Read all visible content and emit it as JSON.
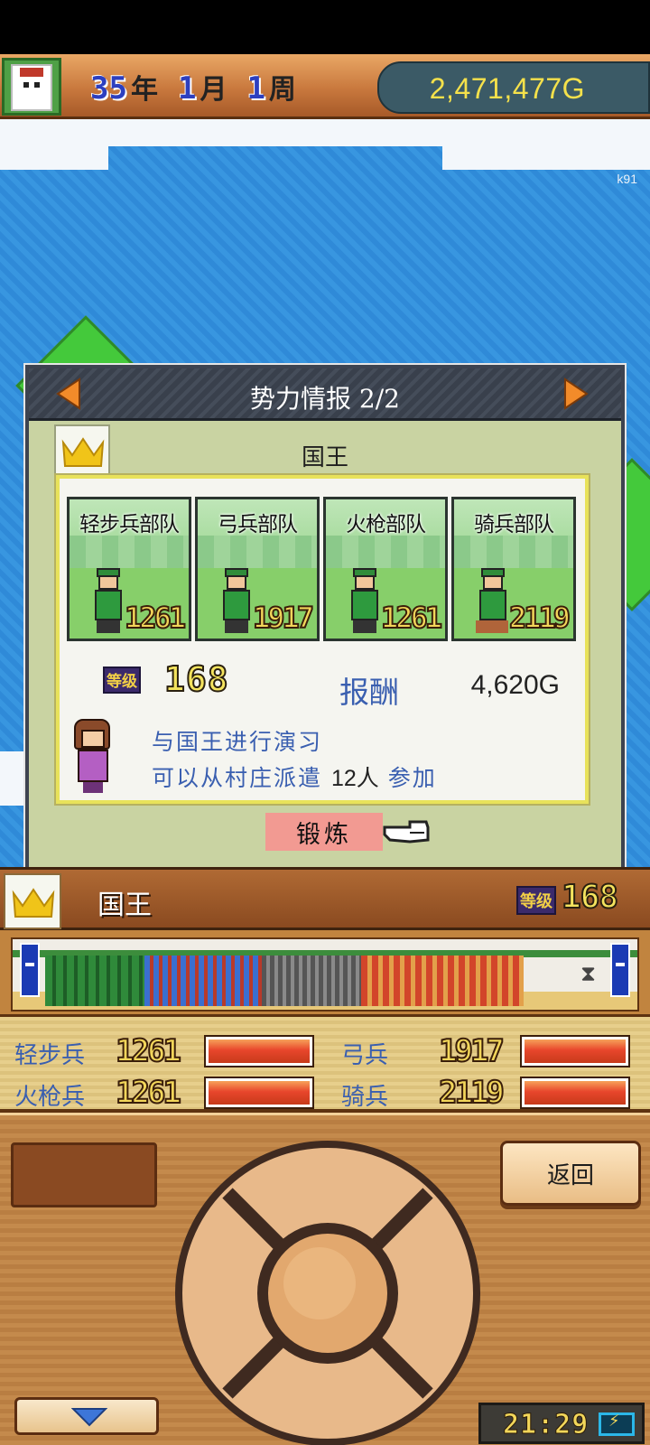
{
  "header": {
    "year": "35",
    "year_unit": "年",
    "month": "1",
    "month_unit": "月",
    "week": "1",
    "week_unit": "周",
    "gold": "2,471,477G"
  },
  "map": {
    "watermark": "k91"
  },
  "dialog": {
    "title": "势力情报 2/2",
    "king_title": "国王",
    "units": [
      {
        "name": "轻步兵部队",
        "count": "1261"
      },
      {
        "name": "弓兵部队",
        "count": "1917"
      },
      {
        "name": "火枪部队",
        "count": "1261"
      },
      {
        "name": "骑兵部队",
        "count": "2119"
      }
    ],
    "level_badge": "等级",
    "level": "168",
    "reward_label": "报酬",
    "reward_value": "4,620G",
    "desc_line1": "与国王进行演习",
    "desc_line2_prefix": "可以从村庄派遣",
    "desc_line2_num": "12人",
    "desc_line2_suffix": "参加",
    "train_button": "锻炼"
  },
  "infobar": {
    "name": "国王",
    "level_badge": "等级",
    "level": "168"
  },
  "stats": [
    {
      "label": "轻步兵",
      "value": "1261",
      "fill": 1.0
    },
    {
      "label": "弓兵",
      "value": "1917",
      "fill": 1.0
    },
    {
      "label": "火枪兵",
      "value": "1261",
      "fill": 1.0
    },
    {
      "label": "骑兵",
      "value": "2119",
      "fill": 1.0
    }
  ],
  "controls": {
    "back_button": "返回",
    "clock": "21:29"
  },
  "colors": {
    "accent_blue": "#3a5fb0",
    "gold_text": "#f5e14b",
    "bar_red": "#e8462c"
  }
}
